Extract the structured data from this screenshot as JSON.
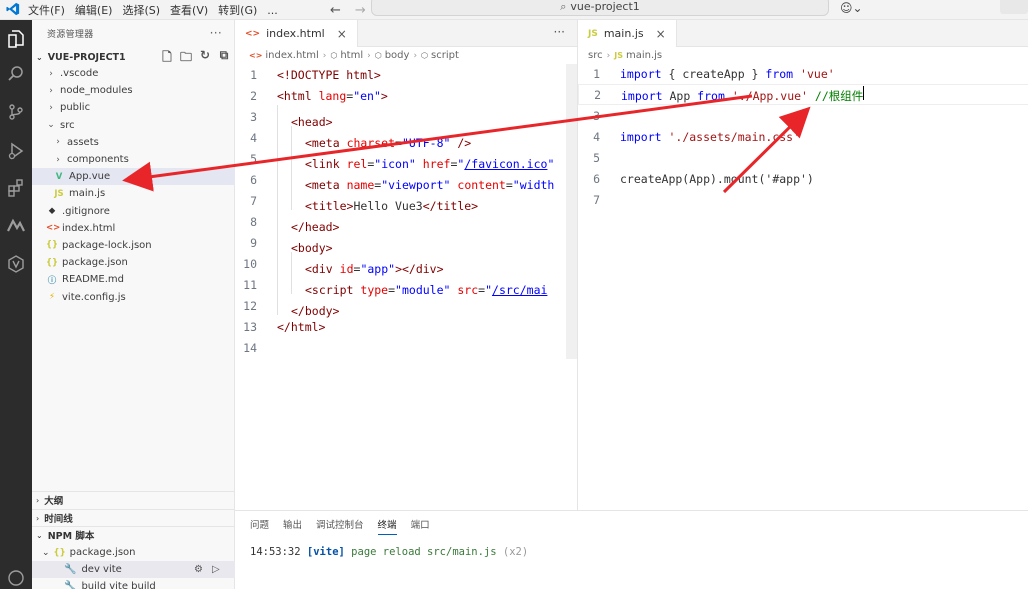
{
  "titlebar": {
    "menu": [
      "文件(F)",
      "编辑(E)",
      "选择(S)",
      "查看(V)",
      "转到(G)"
    ],
    "more": "...",
    "back": "←",
    "forward": "→",
    "search_text": "vue-project1"
  },
  "sidebar": {
    "title": "资源管理器",
    "more": "···",
    "project": "VUE-PROJECT1",
    "tree": [
      {
        "name": ".vscode",
        "type": "folder",
        "depth": 1,
        "chev": "›"
      },
      {
        "name": "node_modules",
        "type": "folder",
        "depth": 1,
        "chev": "›"
      },
      {
        "name": "public",
        "type": "folder",
        "depth": 1,
        "chev": "›"
      },
      {
        "name": "src",
        "type": "folder",
        "depth": 1,
        "chev": "⌄"
      },
      {
        "name": "assets",
        "type": "folder",
        "depth": 2,
        "chev": "›"
      },
      {
        "name": "components",
        "type": "folder",
        "depth": 2,
        "chev": "›"
      },
      {
        "name": "App.vue",
        "type": "vue",
        "depth": 2,
        "icon": "V"
      },
      {
        "name": "main.js",
        "type": "js",
        "depth": 2,
        "icon": "JS"
      },
      {
        "name": ".gitignore",
        "type": "git",
        "depth": 1,
        "icon": "◆"
      },
      {
        "name": "index.html",
        "type": "html",
        "depth": 1,
        "icon": "<>"
      },
      {
        "name": "package-lock.json",
        "type": "json",
        "depth": 1,
        "icon": "{}"
      },
      {
        "name": "package.json",
        "type": "json",
        "depth": 1,
        "icon": "{}"
      },
      {
        "name": "README.md",
        "type": "md",
        "depth": 1,
        "icon": "ⓘ"
      },
      {
        "name": "vite.config.js",
        "type": "vite",
        "depth": 1,
        "icon": "⚡"
      }
    ],
    "sections": {
      "outline": "大纲",
      "timeline": "时间线",
      "npm": "NPM 脚本"
    },
    "npm": {
      "package": "package.json",
      "scripts": [
        "dev  vite",
        "build  vite build"
      ]
    }
  },
  "editor1": {
    "tab_label": "index.html",
    "tab_icon": "<>",
    "close": "×",
    "more": "···",
    "breadcrumb": [
      "index.html",
      "html",
      "body",
      "script"
    ],
    "lines": [
      {
        "n": "1"
      },
      {
        "n": "2"
      },
      {
        "n": "3"
      },
      {
        "n": "4"
      },
      {
        "n": "5"
      },
      {
        "n": "6"
      },
      {
        "n": "7"
      },
      {
        "n": "8"
      },
      {
        "n": "9"
      },
      {
        "n": "10"
      },
      {
        "n": "11"
      },
      {
        "n": "12"
      },
      {
        "n": "13"
      },
      {
        "n": "14"
      }
    ],
    "code": {
      "doctype": "<!DOCTYPE html>",
      "html_open": "<html",
      "lang_attr": "lang",
      "lang_val": "\"en\"",
      "gt": ">",
      "head_open": "<head>",
      "meta_open": "<meta",
      "charset_attr": "charset",
      "charset_val": "\"UTF-8\"",
      "selfclose": " />",
      "link_open": "<link",
      "rel_attr": "rel",
      "rel_val": "\"icon\"",
      "href_attr": "href",
      "href_val": "/favicon.ico",
      "quote": "\"",
      "name_attr": "name",
      "viewport_val": "\"viewport\"",
      "content_attr": "content",
      "content_val": "\"width",
      "title_open": "<title>",
      "title_text": "Hello Vue3",
      "title_close": "</title>",
      "head_close": "</head>",
      "body_open": "<body>",
      "div_open": "<div",
      "id_attr": "id",
      "id_val": "\"app\"",
      "div_close": "></div>",
      "script_open": "<script",
      "type_attr": "type",
      "type_val": "\"module\"",
      "src_attr": "src",
      "src_val": "/src/mai",
      "body_close": "</body>",
      "html_close": "</html>"
    }
  },
  "editor2": {
    "tab_label": "main.js",
    "tab_icon": "JS",
    "close": "×",
    "breadcrumb": [
      "src",
      "main.js"
    ],
    "breadcrumb_icon": "JS",
    "lines": [
      "1",
      "2",
      "3",
      "4",
      "5",
      "6",
      "7"
    ],
    "code": {
      "import": "import",
      "from": "from",
      "l1_mid": " { createApp } ",
      "l1_str": "'vue'",
      "l2_mid": " App ",
      "l2_str": "'./App.vue'",
      "l2_comment": " //根组件",
      "l4_str": "'./assets/main.css'",
      "l6": "createApp(App).mount('#app')"
    }
  },
  "panel": {
    "tabs": [
      "问题",
      "输出",
      "调试控制台",
      "终端",
      "端口"
    ],
    "active_tab": "终端",
    "terminal": {
      "time": "14:53:32",
      "tag": "[vite]",
      "message": "page reload src/main.js",
      "count": "(x2)"
    }
  },
  "colors": {
    "activitybar": "#2c2c2c",
    "arrow": "#e8262a",
    "accent": "#005fb8",
    "vue": "#41b883",
    "js": "#cbcb41"
  }
}
